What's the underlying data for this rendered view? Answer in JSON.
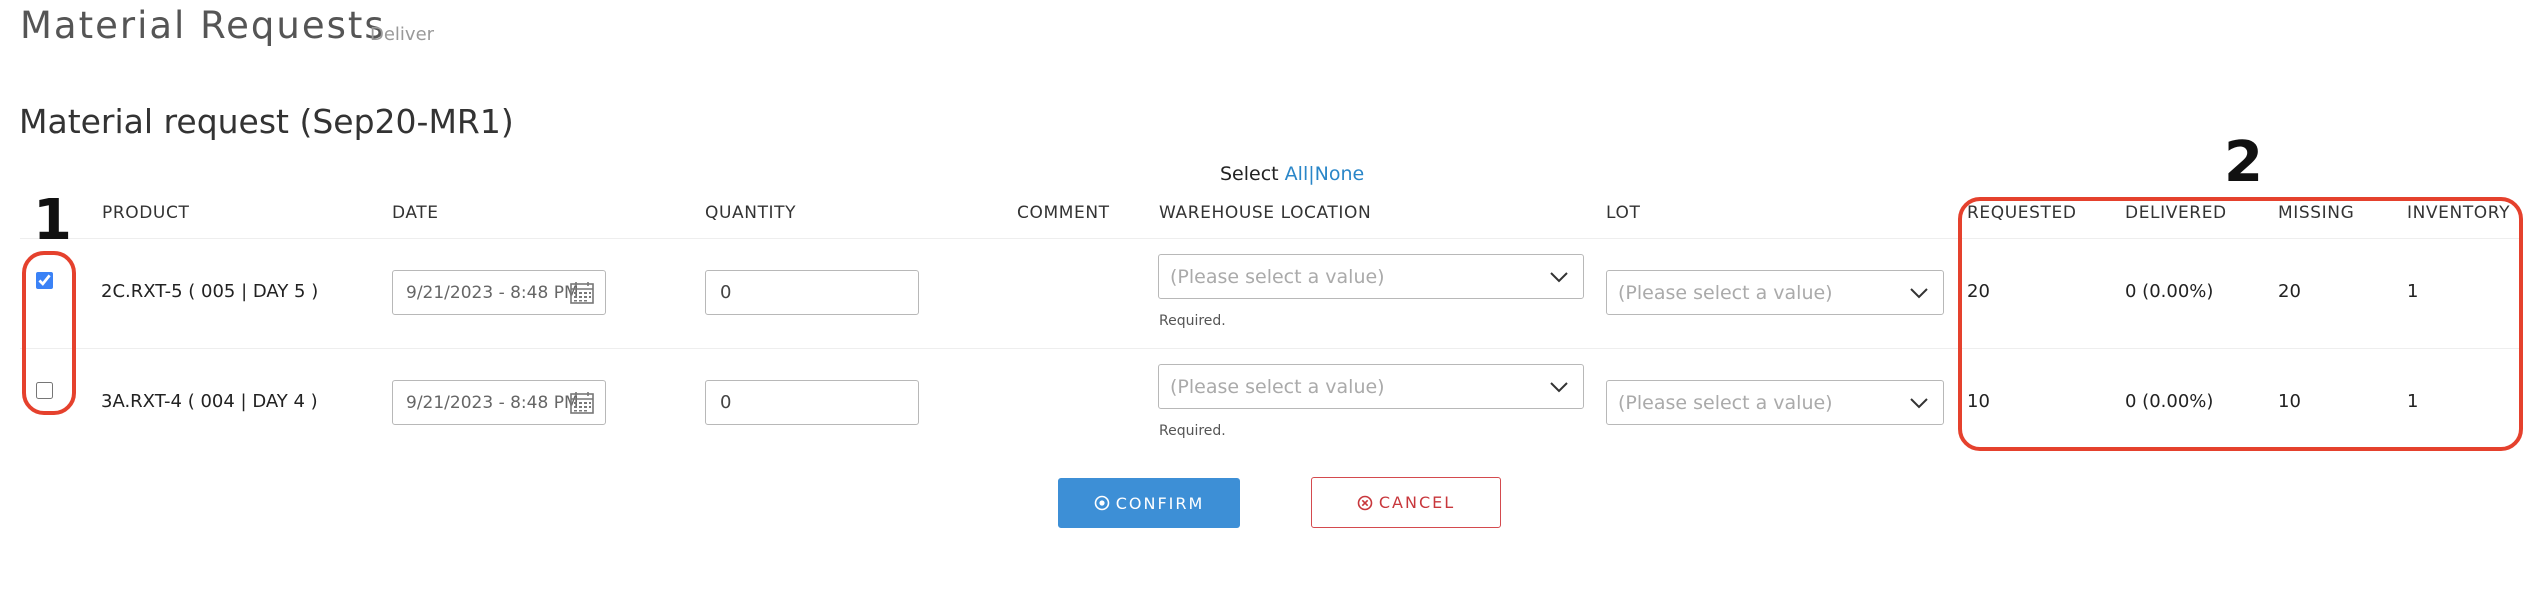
{
  "header": {
    "title": "Material Requests",
    "subtitle": "Deliver"
  },
  "section": {
    "title": "Material request (Sep20-MR1)"
  },
  "select_bar": {
    "label": "Select",
    "all": "All",
    "separator": "|",
    "none": "None"
  },
  "columns": {
    "product": "PRODUCT",
    "date": "DATE",
    "quantity": "QUANTITY",
    "comment": "COMMENT",
    "warehouse": "WAREHOUSE LOCATION",
    "lot": "LOT",
    "requested": "REQUESTED",
    "delivered": "DELIVERED",
    "missing": "MISSING",
    "inventory": "INVENTORY"
  },
  "rows": [
    {
      "checked": true,
      "product": "2C.RXT-5 ( 005 | DAY 5 )",
      "date": "9/21/2023 - 8:48 PM",
      "quantity": "0",
      "warehouse_placeholder": "(Please select a value)",
      "warehouse_hint": "Required.",
      "lot_placeholder": "(Please select a value)",
      "requested": "20",
      "delivered": "0 (0.00%)",
      "missing": "20",
      "inventory": "1"
    },
    {
      "checked": false,
      "product": "3A.RXT-4 ( 004 | DAY 4 )",
      "date": "9/21/2023 - 8:48 PM",
      "quantity": "0",
      "warehouse_placeholder": "(Please select a value)",
      "warehouse_hint": "Required.",
      "lot_placeholder": "(Please select a value)",
      "requested": "10",
      "delivered": "0 (0.00%)",
      "missing": "10",
      "inventory": "1"
    }
  ],
  "actions": {
    "confirm": "CONFIRM",
    "cancel": "CANCEL"
  },
  "annotations": {
    "label_1": "1",
    "label_2": "2"
  },
  "colors": {
    "accent": "#3d8fd6",
    "link": "#2a86c8",
    "cancel": "#c8373c",
    "annotation": "#e5412d"
  },
  "icons": {
    "date": "calendar-icon",
    "select": "chevron-down-icon",
    "confirm": "circle-check-icon",
    "cancel": "circle-x-icon"
  }
}
